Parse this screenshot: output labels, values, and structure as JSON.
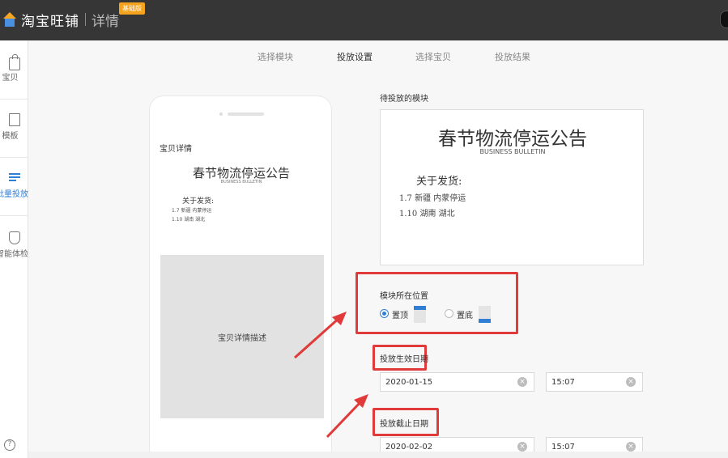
{
  "header": {
    "app_name": "淘宝旺铺",
    "section": "详情",
    "badge": "基础版"
  },
  "sidebar": {
    "items": [
      {
        "label": "宝贝",
        "icon": "bag-icon"
      },
      {
        "label": "模板",
        "icon": "folder-icon"
      },
      {
        "label": "批量投放",
        "icon": "list-icon",
        "active": true
      },
      {
        "label": "智能体检",
        "icon": "shield-icon"
      }
    ],
    "help_icon": "?"
  },
  "steps": [
    "选择模块",
    "投放设置",
    "选择宝贝",
    "投放结果"
  ],
  "phone": {
    "label": "宝贝详情",
    "title": "春节物流停运公告",
    "subtitle": "BUSINESS BULLETIN",
    "line1": "关于发货:",
    "line2": "1.7  新疆 内蒙停运",
    "line3": "1.10  湖南 湖北",
    "desc": "宝贝详情描述"
  },
  "preview": {
    "section_title": "待投放的模块",
    "title": "春节物流停运公告",
    "subtitle": "BUSINESS BULLETIN",
    "line1": "关于发货:",
    "line2": "1.7  新疆 内蒙停运",
    "line3": "1.10  湖南 湖北"
  },
  "position": {
    "label": "模块所在位置",
    "top": "置顶",
    "bottom": "置底",
    "selected": "置顶"
  },
  "start": {
    "label": "投放生效日期",
    "date": "2020-01-15",
    "time": "15:07"
  },
  "end": {
    "label": "投放截止日期",
    "date": "2020-02-02",
    "time": "15:07"
  },
  "colors": {
    "accent": "#2f7fd6",
    "highlight": "#e03a3a",
    "topbar": "#363636"
  }
}
